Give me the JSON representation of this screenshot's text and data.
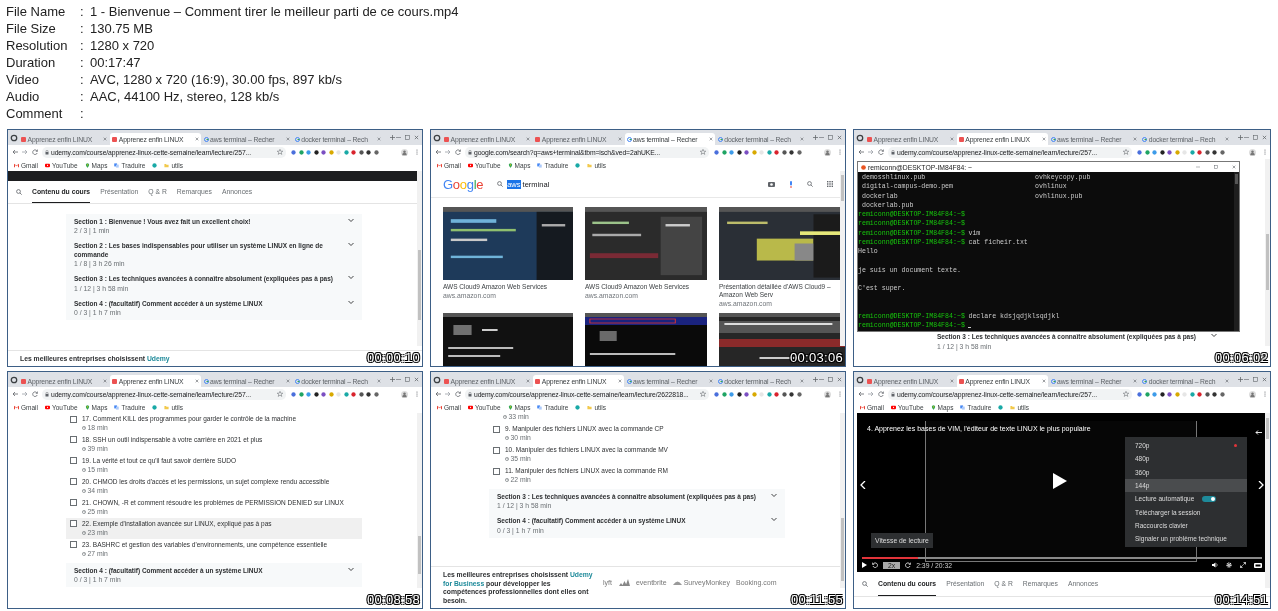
{
  "info": [
    {
      "label": "File Name",
      "separator": ":",
      "value": "1 - Bienvenue – Comment tirer le meilleur parti de ce cours.mp4"
    },
    {
      "label": "File Size",
      "separator": ":",
      "value": "130.75 MB"
    },
    {
      "label": "Resolution",
      "separator": ":",
      "value": "1280 x 720"
    },
    {
      "label": "Duration",
      "separator": ":",
      "value": "00:17:47"
    },
    {
      "label": "Video",
      "separator": ":",
      "value": "AVC, 1280 x 720 (16:9), 30.00 fps, 897 kb/s"
    },
    {
      "label": "Audio",
      "separator": ":",
      "value": "AAC, 44100 Hz, stereo, 128 kb/s"
    },
    {
      "label": "Comment",
      "separator": ":"
    }
  ],
  "thumbnails": [
    {
      "timestamp": "00:00:10",
      "kind": "course",
      "browser": {
        "tabs": [
          {
            "kind": "udemy",
            "label": "Apprenez enfin LINUX",
            "selected": false
          },
          {
            "kind": "udemy",
            "label": "Apprenez enfin LINUX",
            "selected": true
          },
          {
            "kind": "google",
            "label": "aws terminal – Recher",
            "selected": false
          },
          {
            "kind": "google",
            "label": "docker terminal – Rech",
            "selected": false
          }
        ],
        "url": "udemy.com/course/apprenez-linux-cette-semaine/learn/lecture/257...",
        "bookmarks": [
          {
            "kind": "gmail",
            "label": "Gmail"
          },
          {
            "kind": "youtube",
            "label": "YouTube"
          },
          {
            "kind": "maps",
            "label": "Maps"
          },
          {
            "kind": "translate",
            "label": "Traduire"
          },
          {
            "kind": "site"
          },
          {
            "kind": "folder",
            "label": "utils"
          }
        ]
      },
      "page_tabs": [
        {
          "label": "Contenu du cours",
          "selected": true
        },
        {
          "label": "Présentation",
          "selected": false
        },
        {
          "label": "Q & R",
          "selected": false
        },
        {
          "label": "Remarques",
          "selected": false
        },
        {
          "label": "Annonces",
          "selected": false
        }
      ],
      "sections": [
        {
          "title": "Section 1 : Bienvenue ! Vous avez fait un excellent choix!",
          "meta": "2 / 3 | 1 min"
        },
        {
          "title": "Section 2 : Les bases indispensables pour utiliser un système LINUX en ligne de commande",
          "meta": "1 / 8 | 3 h 26 min"
        },
        {
          "title": "Section 3 : Les techniques avancées à connaître absolument (expliquées pas à pas)",
          "meta": "1 / 12 | 3 h 58 min"
        },
        {
          "title": "Section 4 : (facultatif) Comment accéder à un système LINUX",
          "meta": "0 / 3 | 1 h 7 min"
        }
      ],
      "footer": {
        "text_before": "Les meilleures entreprises choisissent",
        "highlight": "Udemy"
      }
    },
    {
      "timestamp": "00:03:06",
      "kind": "google",
      "browser": {
        "tabs": [
          {
            "kind": "udemy",
            "label": "Apprenez enfin LINUX",
            "selected": false
          },
          {
            "kind": "udemy",
            "label": "Apprenez enfin LINUX",
            "selected": false
          },
          {
            "kind": "google",
            "label": "aws terminal – Recher",
            "selected": true
          },
          {
            "kind": "google",
            "label": "docker terminal – Rech",
            "selected": false
          }
        ],
        "url": "google.com/search?q=aws+terminal&tbm=isch&ved=2ahUKE...",
        "bookmarks": [
          {
            "kind": "gmail",
            "label": "Gmail"
          },
          {
            "kind": "youtube",
            "label": "YouTube"
          },
          {
            "kind": "maps",
            "label": "Maps"
          },
          {
            "kind": "translate",
            "label": "Traduire"
          },
          {
            "kind": "site"
          },
          {
            "kind": "folder",
            "label": "utils"
          }
        ]
      },
      "logo": "Google",
      "query_selected": "aws",
      "query_rest": "terminal",
      "results": [
        {
          "caption": "AWS Cloud9 Amazon Web Services",
          "source": "aws.amazon.com"
        },
        {
          "caption": "AWS Cloud9 Amazon Web Services",
          "source": "aws.amazon.com"
        },
        {
          "caption": "Présentation détaillée d'AWS Cloud9 – Amazon Web Serv",
          "source": "aws.amazon.com"
        },
        {
          "kind": "picture"
        },
        {
          "kind": "picture"
        },
        {
          "kind": "picture"
        }
      ]
    },
    {
      "timestamp": "00:06:02",
      "kind": "terminal",
      "browser": {
        "tabs": [
          {
            "kind": "udemy",
            "label": "Apprenez enfin LINUX",
            "selected": false
          },
          {
            "kind": "udemy",
            "label": "Apprenez enfin LINUX",
            "selected": true
          },
          {
            "kind": "google",
            "label": "aws terminal – Recher",
            "selected": false
          },
          {
            "kind": "google",
            "label": "docker terminal – Rech",
            "selected": false
          }
        ],
        "url": "udemy.com/course/apprenez-linux-cette-semaine/learn/lecture/257..."
      },
      "terminal_title": "remiconn@DESKTOP-IM84F84: ~",
      "lines": [
        {
          "kind": "files",
          "left": "demosshlinux.pub",
          "right": "ovhkeycopy.pub"
        },
        {
          "kind": "files",
          "left": "digital-campus-demo.pem",
          "right": "ovhlinux"
        },
        {
          "kind": "files",
          "left": "dockerlab",
          "right": "ovhlinux.pub"
        },
        {
          "kind": "files",
          "left": "dockerlab.pub"
        },
        {
          "kind": "prompt",
          "prompt": "remiconn@DESKTOP-IM84F84:~$"
        },
        {
          "kind": "prompt",
          "prompt": "remiconn@DESKTOP-IM84F84:~$"
        },
        {
          "kind": "prompt",
          "prompt": "remiconn@DESKTOP-IM84F84:~$",
          "command": "vim"
        },
        {
          "kind": "prompt",
          "prompt": "remiconn@DESKTOP-IM84F84:~$",
          "command": "cat ficheir.txt"
        },
        {
          "kind": "output",
          "text": "Hello"
        },
        {
          "kind": "blank"
        },
        {
          "kind": "output",
          "text": "je suis un document texte."
        },
        {
          "kind": "blank"
        },
        {
          "kind": "output",
          "text": "C'est super."
        },
        {
          "kind": "blank"
        },
        {
          "kind": "blank"
        },
        {
          "kind": "prompt",
          "prompt": "remiconn@DESKTOP-IM84F84:~$",
          "command": "declare kdsjqdjklsqdjkl"
        },
        {
          "kind": "prompt",
          "prompt": "remiconn@DESKTOP-IM84F84:~$",
          "cursor": true
        }
      ],
      "sections": [
        {
          "title": "Section 3 : Les techniques avancées à connaître absolument (expliquées pas à pas)",
          "meta": "1 / 12 | 3 h 58 min"
        }
      ]
    },
    {
      "timestamp": "00:08:58",
      "kind": "lessons",
      "browser": {
        "tabs": [
          {
            "kind": "udemy",
            "label": "Apprenez enfin LINUX",
            "selected": false
          },
          {
            "kind": "udemy",
            "label": "Apprenez enfin LINUX",
            "selected": true
          },
          {
            "kind": "google",
            "label": "aws terminal – Recher",
            "selected": false
          },
          {
            "kind": "google",
            "label": "docker terminal – Rech",
            "selected": false
          }
        ],
        "url": "udemy.com/course/apprenez-linux-cette-semaine/learn/lecture/257...",
        "bookmarks": [
          {
            "kind": "gmail",
            "label": "Gmail"
          },
          {
            "kind": "youtube",
            "label": "YouTube"
          },
          {
            "kind": "maps",
            "label": "Maps"
          },
          {
            "kind": "translate",
            "label": "Traduire"
          },
          {
            "kind": "site"
          },
          {
            "kind": "folder",
            "label": "utils"
          }
        ]
      },
      "lessons": [
        {
          "title": "17. Comment KILL des programmes pour garder le contrôle de la machine",
          "duration": "18 min",
          "checked": false,
          "highlighted": false
        },
        {
          "title": "18. SSH un outil indispensable à votre carrière en 2021 et plus",
          "duration": "39 min",
          "checked": false,
          "highlighted": false
        },
        {
          "title": "19. La vérité et tout ce qu'il faut savoir derrière SUDO",
          "duration": "15 min",
          "checked": false,
          "highlighted": false
        },
        {
          "title": "20. CHMOD les droits d'accès et les permissions, un sujet complexe rendu accessible",
          "duration": "34 min",
          "checked": false,
          "highlighted": false
        },
        {
          "title": "21. CHOWN, -R et comment résoudre les problèmes de PERMISSION DENIED sur LINUX",
          "duration": "25 min",
          "checked": false,
          "highlighted": false
        },
        {
          "title": "22. Exemple d'installation avancée sur LINUX, expliqué pas à pas",
          "duration": "23 min",
          "checked": false,
          "highlighted": true
        },
        {
          "title": "23. BASHRC et gestion des variables d'environnements, une compétence essentielle",
          "duration": "27 min",
          "checked": false,
          "highlighted": false
        }
      ],
      "sections": [
        {
          "title": "Section 4 : (facultatif) Comment accéder à un système LINUX",
          "meta": "0 / 3 | 1 h 7 min"
        }
      ]
    },
    {
      "timestamp": "00:11:55",
      "kind": "lessons",
      "browser": {
        "tabs": [
          {
            "kind": "udemy",
            "label": "Apprenez enfin LINUX",
            "selected": false
          },
          {
            "kind": "udemy",
            "label": "Apprenez enfin LINUX",
            "selected": true
          },
          {
            "kind": "google",
            "label": "aws terminal – Recher",
            "selected": false
          },
          {
            "kind": "google",
            "label": "docker terminal – Rech",
            "selected": false
          }
        ],
        "url": "udemy.com/course/apprenez-linux-cette-semaine/learn/lecture/2622818...",
        "bookmarks": [
          {
            "kind": "gmail",
            "label": "Gmail"
          },
          {
            "kind": "youtube",
            "label": "YouTube"
          },
          {
            "kind": "maps",
            "label": "Maps"
          },
          {
            "kind": "translate",
            "label": "Traduire"
          },
          {
            "kind": "site"
          },
          {
            "kind": "folder",
            "label": "utils"
          }
        ]
      },
      "lessons": [
        {
          "duration": "33 min"
        },
        {
          "title": "9. Manipuler des fichiers LINUX avec la commande CP",
          "duration": "30 min",
          "checked": false,
          "highlighted": false
        },
        {
          "title": "10. Manipuler des fichiers LINUX avec la commande MV",
          "duration": "35 min",
          "checked": false,
          "highlighted": false
        },
        {
          "title": "11. Manipuler des fichiers LINUX avec la commande RM",
          "duration": "22 min",
          "checked": false,
          "highlighted": false
        }
      ],
      "sections": [
        {
          "title": "Section 3 : Les techniques avancées à connaître absolument (expliquées pas à pas)",
          "meta": "1 / 12 | 3 h 58 min"
        },
        {
          "title": "Section 4 : (facultatif) Comment accéder à un système LINUX",
          "meta": "0 / 3 | 1 h 7 min"
        }
      ],
      "footer": {
        "text_before": "Les meilleures entreprises choisissent",
        "highlight": "Udemy for Business",
        "text_after": "pour développer les compétences professionnelles dont elles ont besoin."
      },
      "logos": [
        {
          "kind": "wordmark",
          "label": "lyft"
        },
        {
          "kind": "stripes"
        },
        {
          "kind": "wordmark",
          "label": "eventbrite"
        },
        {
          "kind": "monkey",
          "label": "SurveyMonkey"
        },
        {
          "kind": "wordmark",
          "label": "Booking.com"
        }
      ]
    },
    {
      "timestamp": "00:14:51",
      "kind": "player",
      "browser": {
        "tabs": [
          {
            "kind": "udemy",
            "label": "Apprenez enfin LINUX",
            "selected": false
          },
          {
            "kind": "udemy",
            "label": "Apprenez enfin LINUX",
            "selected": true
          },
          {
            "kind": "google",
            "label": "aws terminal – Recher",
            "selected": false
          },
          {
            "kind": "google",
            "label": "docker terminal – Rech",
            "selected": false
          }
        ],
        "url": "udemy.com/course/apprenez-linux-cette-semaine/learn/lecture/257...",
        "bookmarks": [
          {
            "kind": "gmail",
            "label": "Gmail"
          },
          {
            "kind": "youtube",
            "label": "YouTube"
          },
          {
            "kind": "maps",
            "label": "Maps"
          },
          {
            "kind": "translate",
            "label": "Traduire"
          },
          {
            "kind": "site"
          },
          {
            "kind": "folder",
            "label": "utils"
          }
        ]
      },
      "video_title": "4. Apprenez les bases de VIM, l'éditeur de texte LINUX le plus populaire",
      "menu": [
        {
          "kind": "quality",
          "label": "720p",
          "current": true,
          "selected": false
        },
        {
          "kind": "quality",
          "label": "480p",
          "current": false,
          "selected": false
        },
        {
          "kind": "quality",
          "label": "360p",
          "current": false,
          "selected": false
        },
        {
          "kind": "quality",
          "label": "144p",
          "current": false,
          "selected": true
        },
        {
          "kind": "toggle",
          "label": "Lecture automatique",
          "on": true
        },
        {
          "kind": "action",
          "label": "Télécharger la session"
        },
        {
          "kind": "action",
          "label": "Raccourcis clavier"
        },
        {
          "kind": "action",
          "label": "Signaler un problème technique"
        }
      ],
      "tooltip": "Vitesse de lecture",
      "speed": "2x",
      "time": "2:39 / 20:32",
      "progress": {
        "level": 0.14
      },
      "page_tabs": [
        {
          "label": "Contenu du cours",
          "selected": true
        },
        {
          "label": "Présentation",
          "selected": false
        },
        {
          "label": "Q & R",
          "selected": false
        },
        {
          "label": "Remarques",
          "selected": false
        },
        {
          "label": "Annonces",
          "selected": false
        }
      ]
    }
  ]
}
